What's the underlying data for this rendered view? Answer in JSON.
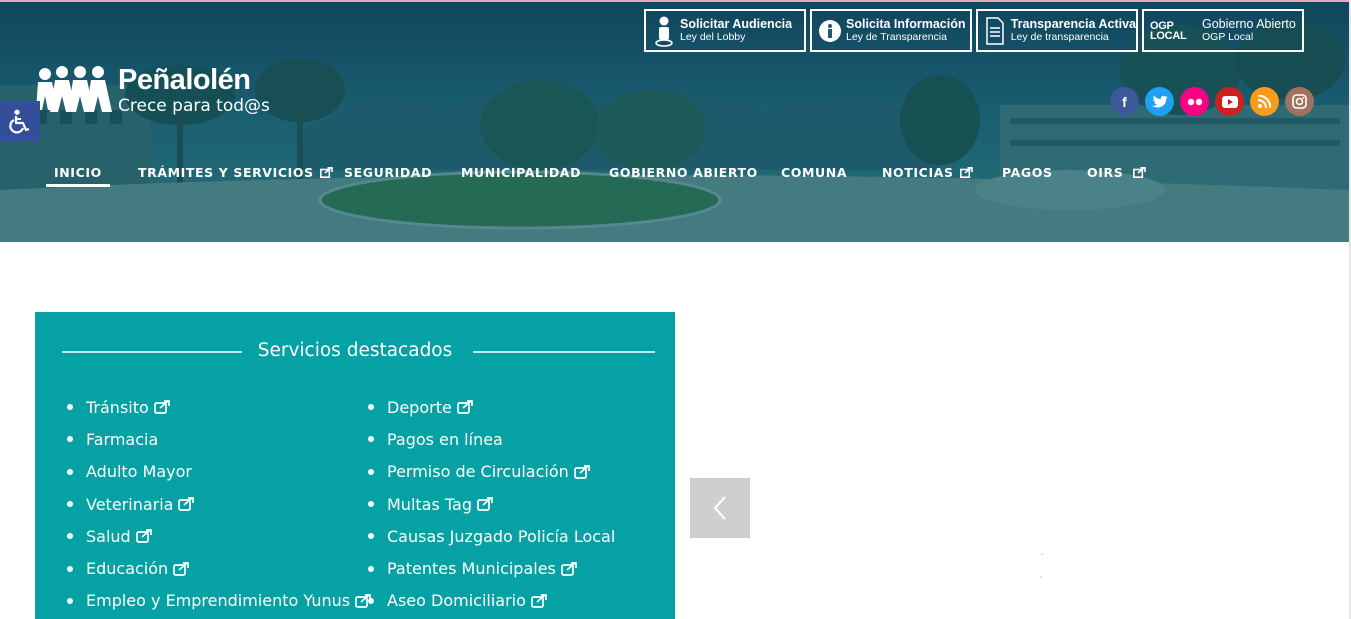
{
  "quick_links": [
    {
      "title": "Solicitar Audiencia",
      "subtitle": "Ley del Lobby",
      "icon": "person-icon"
    },
    {
      "title": "Solicita Información",
      "subtitle": "Ley de Transparencia",
      "icon": "info-icon"
    },
    {
      "title": "Transparencia Activa",
      "subtitle": "Ley de transparencia",
      "icon": "document-icon"
    },
    {
      "badge": "OGP LOCAL",
      "title": "Gobierno Abierto",
      "subtitle": "OGP Local",
      "icon": "ogp-local-logo"
    }
  ],
  "logo": {
    "name": "Peñalolén",
    "tagline": "Crece para tod@s"
  },
  "social": [
    {
      "name": "facebook",
      "glyph": "f",
      "color": "#3b5998"
    },
    {
      "name": "twitter",
      "glyph": "t",
      "color": "#1da1f2"
    },
    {
      "name": "flickr",
      "glyph": "••",
      "color": "#ff0084"
    },
    {
      "name": "youtube",
      "glyph": "▶",
      "color": "#cd201f"
    },
    {
      "name": "rss",
      "glyph": "rss",
      "color": "#f99c1c"
    },
    {
      "name": "instagram",
      "glyph": "ig",
      "color": "#a0745c"
    }
  ],
  "nav": [
    {
      "label": "INICIO",
      "active": true,
      "external": false
    },
    {
      "label": "TRÁMITES Y SERVICIOS",
      "active": false,
      "external": true
    },
    {
      "label": "SEGURIDAD",
      "active": false,
      "external": false
    },
    {
      "label": "MUNICIPALIDAD",
      "active": false,
      "external": false
    },
    {
      "label": "GOBIERNO ABIERTO",
      "active": false,
      "external": false
    },
    {
      "label": "COMUNA",
      "active": false,
      "external": false
    },
    {
      "label": "NOTICIAS",
      "active": false,
      "external": true
    },
    {
      "label": "PAGOS",
      "active": false,
      "external": false
    },
    {
      "label": "OIRS",
      "active": false,
      "external": true
    }
  ],
  "services": {
    "title": "Servicios destacados",
    "left": [
      {
        "label": "Tránsito",
        "external": true
      },
      {
        "label": "Farmacia",
        "external": false
      },
      {
        "label": "Adulto Mayor",
        "external": false
      },
      {
        "label": "Veterinaria",
        "external": true
      },
      {
        "label": "Salud",
        "external": true
      },
      {
        "label": "Educación",
        "external": true
      },
      {
        "label": "Empleo y Emprendimiento Yunus",
        "external": true
      }
    ],
    "right": [
      {
        "label": "Deporte",
        "external": true
      },
      {
        "label": "Pagos en línea",
        "external": false
      },
      {
        "label": "Permiso de Circulación",
        "external": true
      },
      {
        "label": "Multas Tag",
        "external": true
      },
      {
        "label": "Causas Juzgado Policía Local",
        "external": false
      },
      {
        "label": "Patentes Municipales",
        "external": true
      },
      {
        "label": "Aseo Domiciliario",
        "external": true
      }
    ]
  },
  "colors": {
    "panel": "#06a1a5",
    "access_button": "#334f9c",
    "header_tint": "#1f5a6e"
  }
}
